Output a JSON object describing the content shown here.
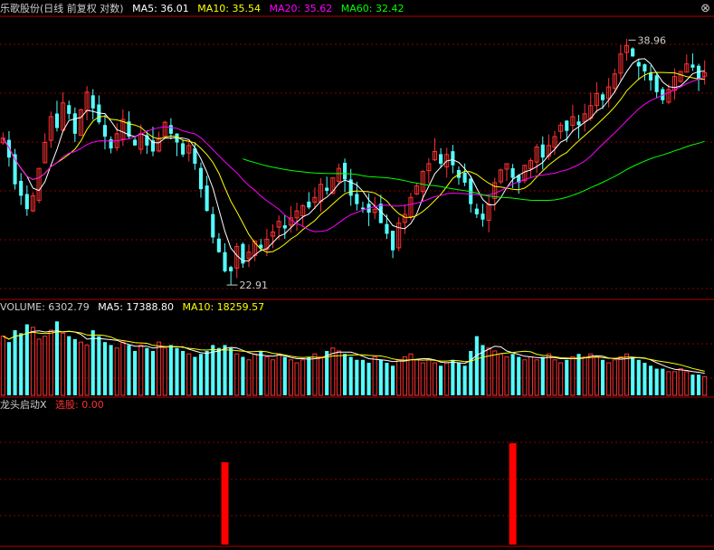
{
  "header": {
    "title": "乐歌股份(日线 前复权 对数)",
    "ma5": "MA5: 36.01",
    "ma10": "MA10: 35.54",
    "ma20": "MA20: 35.62",
    "ma60": "MA60: 32.42",
    "close_glyph": "⊗"
  },
  "volume_header": {
    "volume": "VOLUME: 6302.79",
    "ma5": "MA5: 17388.80",
    "ma10": "MA10: 18259.57"
  },
  "indicator_header": {
    "name": "龙头启动X",
    "signal": "选股: 0.00"
  },
  "annotations": {
    "high": "38.96",
    "low": "22.91"
  },
  "colors": {
    "up": "#ff3232",
    "down": "#54ffff",
    "ma5": "#ffffff",
    "ma10": "#ffff00",
    "ma20": "#ff00ff",
    "ma60": "#00ff00",
    "signal": "#ff0000",
    "grid": "#8b0000"
  },
  "chart_data": [
    {
      "type": "candlestick",
      "closes": [
        31.5,
        30.2,
        28.5,
        27.8,
        27.0,
        27.8,
        29.5,
        31.2,
        33.0,
        32.2,
        34.0,
        33.2,
        31.8,
        33.5,
        34.8,
        33.6,
        32.6,
        31.6,
        30.8,
        31.8,
        32.8,
        31.6,
        31.0,
        31.8,
        31.0,
        30.6,
        31.5,
        32.6,
        31.8,
        31.2,
        30.4,
        31.0,
        29.8,
        28.2,
        26.9,
        25.4,
        24.6,
        23.6,
        23.6,
        24.9,
        24.0,
        24.6,
        25.2,
        24.8,
        25.3,
        25.7,
        26.3,
        25.9,
        26.5,
        26.9,
        27.2,
        27.1,
        27.7,
        28.5,
        28.1,
        28.9,
        29.5,
        28.8,
        27.8,
        27.3,
        27.0,
        26.8,
        27.0,
        26.2,
        25.6,
        24.7,
        26.2,
        26.7,
        27.7,
        28.4,
        29.3,
        29.8,
        30.6,
        29.8,
        30.4,
        29.7,
        28.9,
        28.6,
        27.3,
        26.7,
        26.4,
        27.3,
        28.6,
        29.4,
        29.8,
        28.9,
        28.6,
        29.7,
        30.0,
        30.9,
        30.2,
        31.0,
        31.6,
        32.4,
        32.0,
        33.0,
        32.4,
        33.2,
        33.8,
        34.7,
        34.2,
        35.2,
        36.2,
        37.8,
        38.5,
        37.6,
        36.8,
        36.4,
        35.7,
        34.8,
        34.2,
        35.0,
        36.0,
        36.4,
        37.0,
        36.7,
        35.8,
        36.3
      ],
      "y_axis": "log",
      "high_label": "38.96",
      "low_label": "22.91"
    },
    {
      "type": "bar",
      "series_volume": [
        20000,
        18000,
        22000,
        21000,
        24000,
        23000,
        19000,
        20000,
        22000,
        25000,
        21000,
        20000,
        19000,
        18000,
        17000,
        22000,
        20000,
        18000,
        17000,
        16000,
        18000,
        17000,
        15000,
        17000,
        16000,
        15000,
        18000,
        16000,
        17000,
        16000,
        15000,
        14000,
        13000,
        14000,
        15000,
        17000,
        16000,
        17000,
        16000,
        14000,
        13000,
        12000,
        14000,
        15000,
        13000,
        12000,
        14000,
        13000,
        12000,
        11000,
        12000,
        13000,
        14000,
        13000,
        15000,
        16000,
        15000,
        14000,
        13000,
        12000,
        12000,
        11000,
        13000,
        12000,
        11000,
        10000,
        12000,
        13000,
        14000,
        12000,
        11000,
        12000,
        11000,
        10000,
        11000,
        12000,
        11000,
        10000,
        15000,
        20000,
        17000,
        16000,
        15000,
        14000,
        13000,
        14000,
        13000,
        12000,
        13000,
        12000,
        13000,
        14000,
        12000,
        11000,
        12000,
        13000,
        14000,
        13000,
        14000,
        13000,
        12000,
        11000,
        12000,
        13000,
        14000,
        13000,
        12000,
        11000,
        10000,
        9000,
        9000,
        8000,
        8000,
        9000,
        8000,
        7000,
        7000,
        6302.79
      ],
      "volume_ma5": 17388.8,
      "volume_ma10": 18259.57
    },
    {
      "type": "bar",
      "name": "选股",
      "signal_indices": [
        37,
        85
      ],
      "value": 0.0
    }
  ]
}
